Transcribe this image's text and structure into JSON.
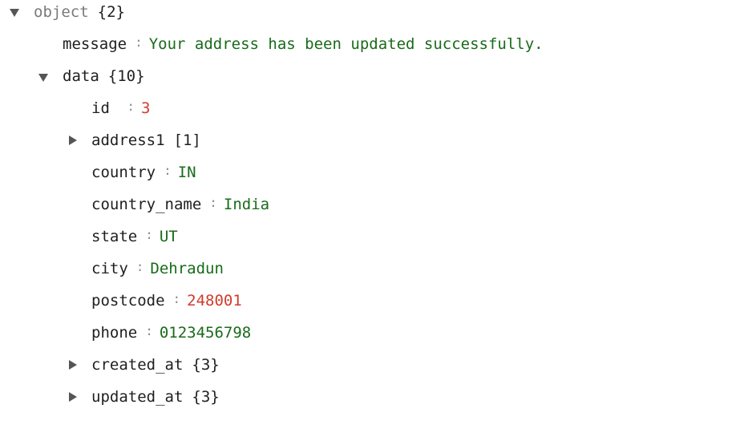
{
  "root": {
    "key": "object",
    "count": "{2}"
  },
  "message": {
    "key": "message",
    "sep": ":",
    "value": "Your address has been updated successfully."
  },
  "data": {
    "key": "data",
    "count": "{10}",
    "id": {
      "key": "id ",
      "sep": ":",
      "value": "3"
    },
    "address1": {
      "key": "address1",
      "count": "[1]"
    },
    "country": {
      "key": "country",
      "sep": ":",
      "value": "IN"
    },
    "country_name": {
      "key": "country_name",
      "sep": ":",
      "value": "India"
    },
    "state": {
      "key": "state",
      "sep": ":",
      "value": "UT"
    },
    "city": {
      "key": "city",
      "sep": ":",
      "value": "Dehradun"
    },
    "postcode": {
      "key": "postcode",
      "sep": ":",
      "value": "248001"
    },
    "phone": {
      "key": "phone",
      "sep": ":",
      "value": "0123456798"
    },
    "created_at": {
      "key": "created_at",
      "count": "{3}"
    },
    "updated_at": {
      "key": "updated_at",
      "count": "{3}"
    }
  },
  "colors": {
    "string": "#196b1a",
    "number": "#d13b2c",
    "muted": "#7a7a7a",
    "toggle": "#555555"
  },
  "icons": {
    "expanded": "triangle-down-icon",
    "collapsed": "triangle-right-icon"
  }
}
